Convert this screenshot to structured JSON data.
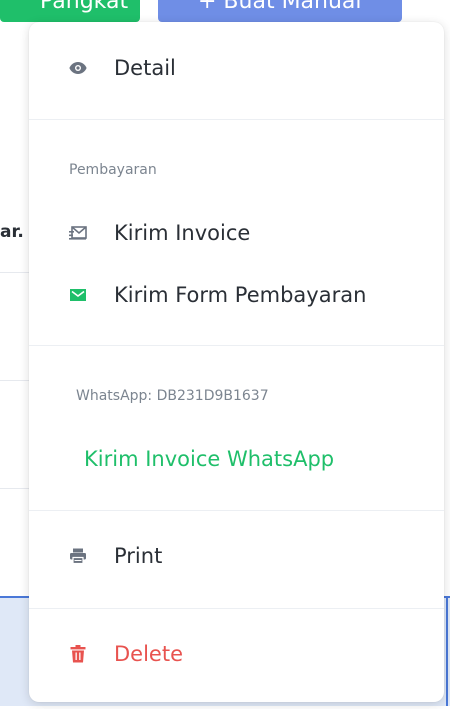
{
  "background": {
    "button_green_label": "Pangkat",
    "button_blue_label": "+ Buat Manual",
    "partial_text": "ar."
  },
  "menu": {
    "detail_label": "Detail",
    "pembayaran_section_label": "Pembayaran",
    "kirim_invoice_label": "Kirim Invoice",
    "kirim_form_label": "Kirim Form Pembayaran",
    "whatsapp_label": "WhatsApp: DB231D9B1637",
    "kirim_invoice_whatsapp_label": "Kirim Invoice WhatsApp",
    "print_label": "Print",
    "delete_label": "Delete"
  },
  "icons": {
    "detail": "eye-icon",
    "kirim_invoice": "send-mail-icon",
    "kirim_form": "envelope-icon",
    "print": "print-icon",
    "delete": "trash-icon"
  },
  "colors": {
    "accent_green": "#1fbf6a",
    "danger_red": "#e8534f",
    "icon_gray": "#6b7380",
    "text_dark": "#2a2f36",
    "label_gray": "#7c8590",
    "blue_button": "#6f8ee6"
  }
}
